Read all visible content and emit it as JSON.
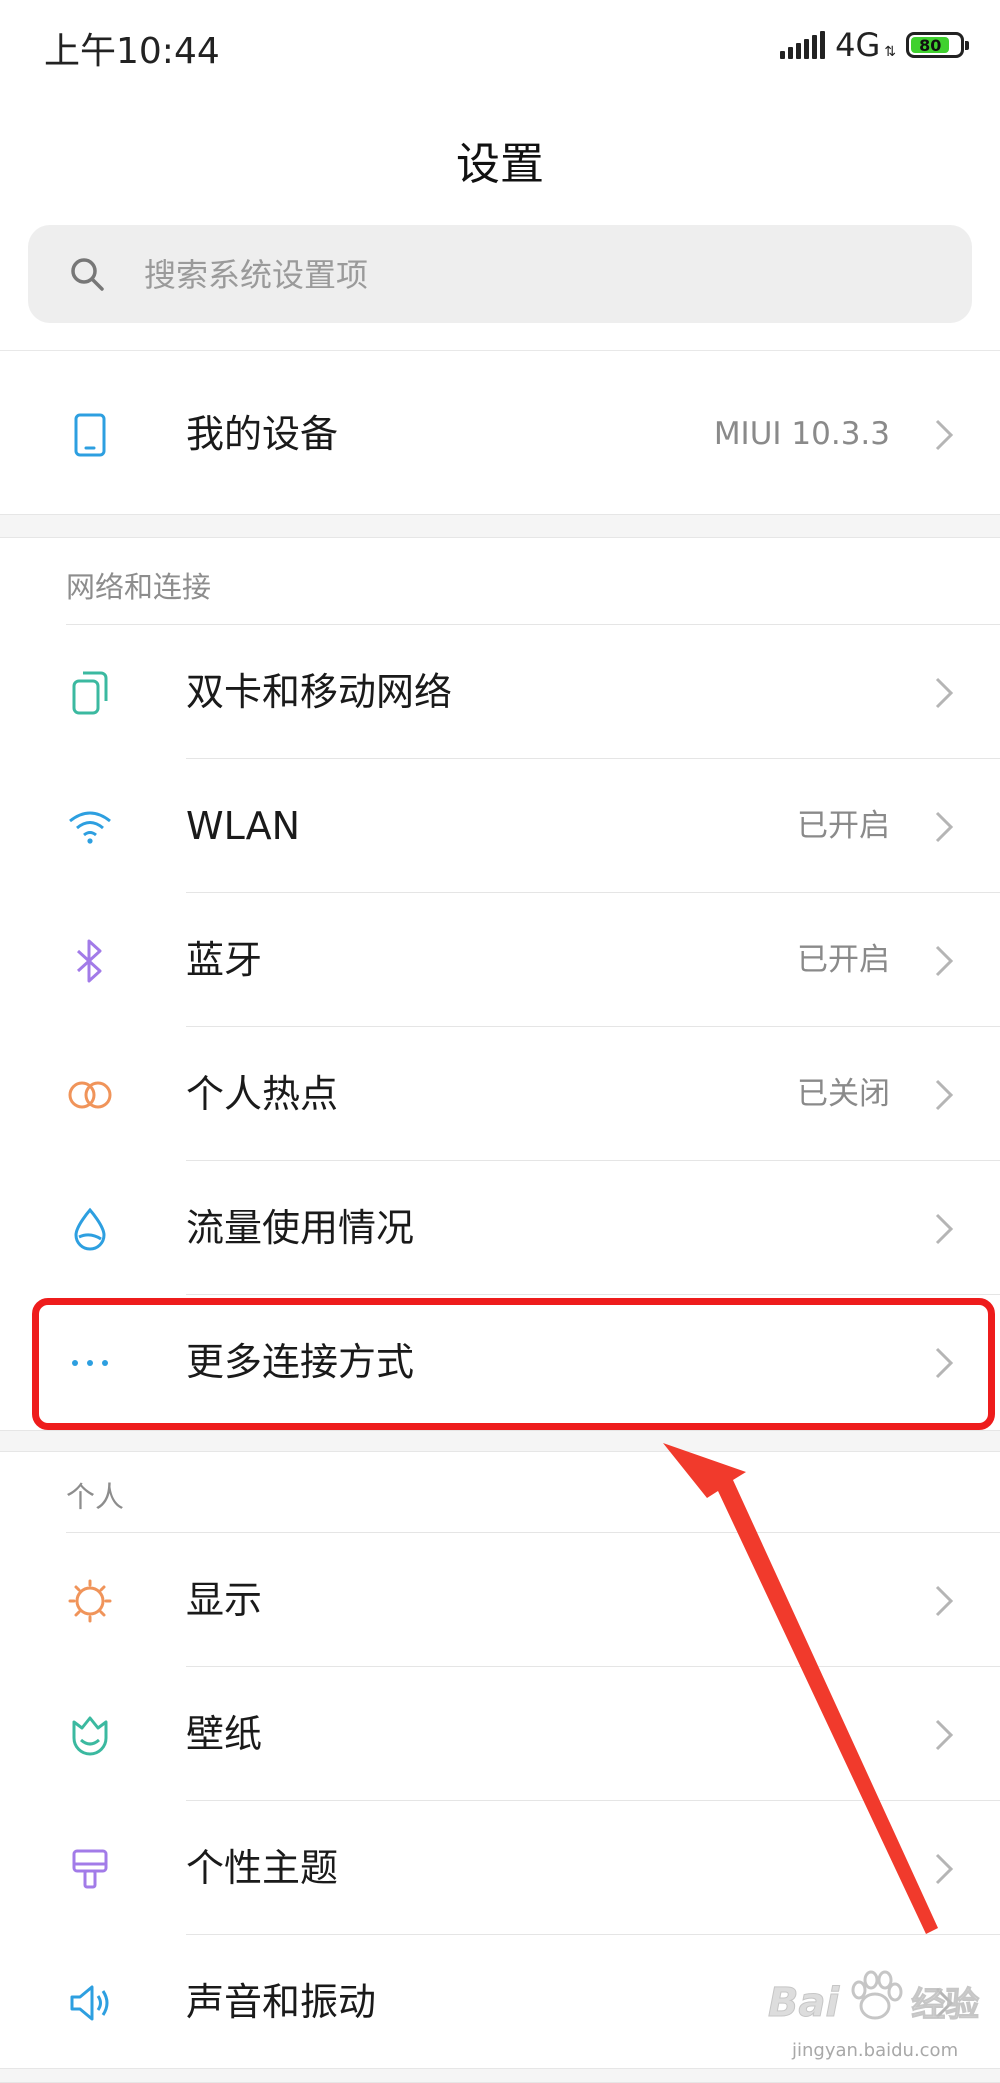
{
  "status_bar": {
    "time": "上午10:44",
    "network": "4G",
    "battery": {
      "level_text": "80",
      "level": 0.8
    }
  },
  "page": {
    "title": "设置",
    "search_placeholder": "搜索系统设置项"
  },
  "device_row": {
    "label": "我的设备",
    "value": "MIUI 10.3.3",
    "icon": "phone-icon"
  },
  "sections": {
    "network": {
      "header": "网络和连接",
      "items": [
        {
          "label": "双卡和移动网络",
          "value": "",
          "icon": "dual-sim-icon",
          "color": "#3bb9a0"
        },
        {
          "label": "WLAN",
          "value": "已开启",
          "icon": "wifi-icon",
          "color": "#2d9fe0"
        },
        {
          "label": "蓝牙",
          "value": "已开启",
          "icon": "bluetooth-icon",
          "color": "#a27be8"
        },
        {
          "label": "个人热点",
          "value": "已关闭",
          "icon": "hotspot-icon",
          "color": "#f0945a"
        },
        {
          "label": "流量使用情况",
          "value": "",
          "icon": "data-drop-icon",
          "color": "#2d9fe0"
        },
        {
          "label": "更多连接方式",
          "value": "",
          "icon": "more-dots-icon",
          "color": "#2d9fe0"
        }
      ]
    },
    "personal": {
      "header": "个人",
      "items": [
        {
          "label": "显示",
          "value": "",
          "icon": "display-sun-icon",
          "color": "#f0945a"
        },
        {
          "label": "壁纸",
          "value": "",
          "icon": "wallpaper-icon",
          "color": "#3bb9a0"
        },
        {
          "label": "个性主题",
          "value": "",
          "icon": "theme-brush-icon",
          "color": "#a27be8"
        },
        {
          "label": "声音和振动",
          "value": "",
          "icon": "speaker-icon",
          "color": "#2d9fe0"
        }
      ]
    }
  },
  "annotation": {
    "highlight_color": "#ee1c1c"
  },
  "watermark": {
    "brand": "Bai",
    "brand_cn": "经验",
    "url": "jingyan.baidu.com"
  }
}
